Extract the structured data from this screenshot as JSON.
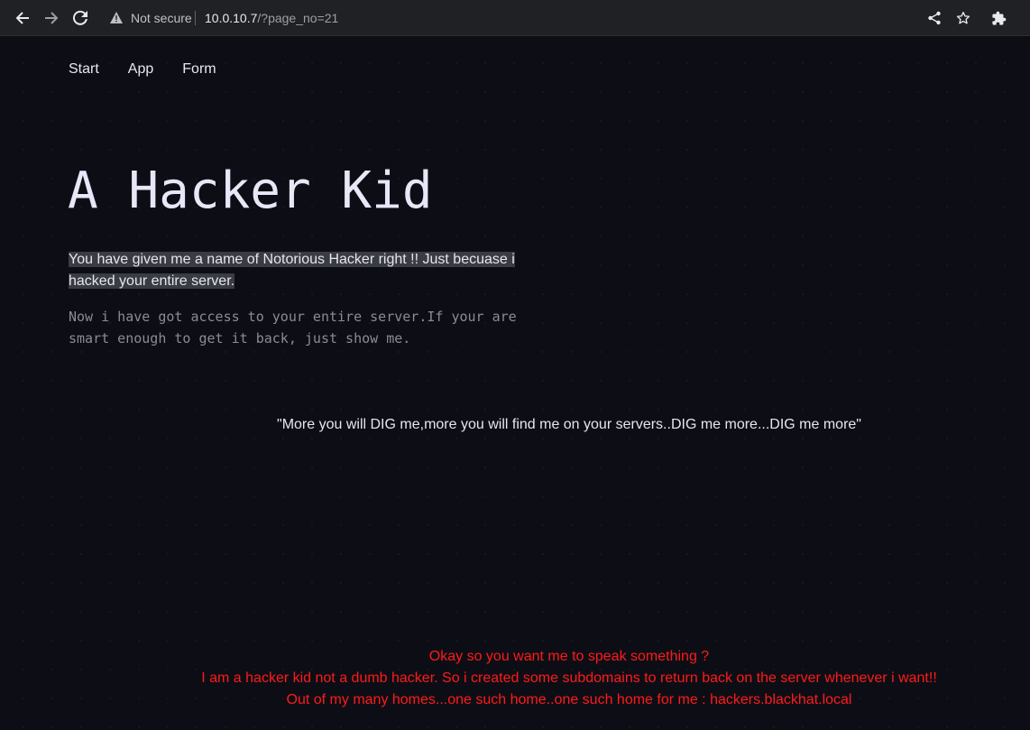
{
  "browser": {
    "security_label": "Not secure",
    "url_host": "10.0.10.7",
    "url_path": "/?page_no=21",
    "icons": {
      "back": "arrow-left-icon",
      "forward": "arrow-right-icon",
      "reload": "reload-icon",
      "warning": "warning-triangle-icon",
      "share": "share-icon",
      "bookmark": "star-icon",
      "extensions": "puzzle-icon"
    }
  },
  "nav": {
    "items": [
      "Start",
      "App",
      "Form"
    ]
  },
  "hero": {
    "title": "A Hacker Kid",
    "highlight_text": "You have given me a name of Notorious Hacker right !! Just becuase i hacked your entire server.",
    "mono_text": "Now i have got access to your entire server.If your are smart enough to get it back, just show me."
  },
  "quote": "\"More you will DIG me,more you will find me on your servers..DIG me more...DIG me more\"",
  "message": {
    "lines": [
      "Okay so you want me to speak something ?",
      "I am a hacker kid not a dumb hacker. So i created some subdomains to return back on the server whenever i want!!",
      "Out of my many homes...one such home..one such home for me : hackers.blackhat.local"
    ],
    "color": "#ff1a1a"
  },
  "colors": {
    "page_background": "#0d0e15",
    "toolbar_background": "#202124",
    "highlight_background": "#3a3c43"
  }
}
